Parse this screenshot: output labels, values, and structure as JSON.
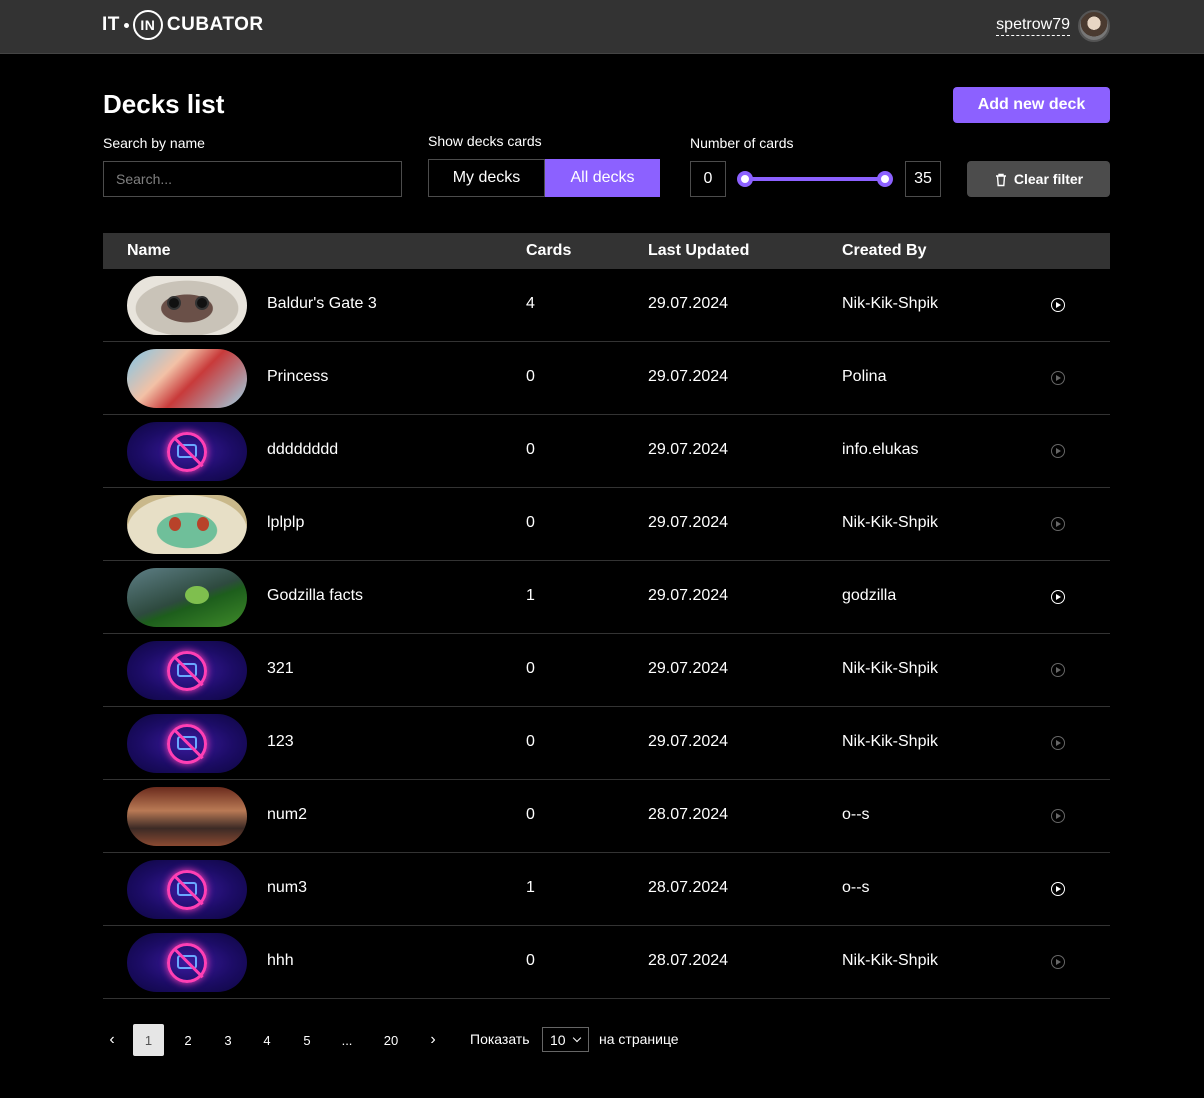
{
  "header": {
    "logo_left": "IT",
    "logo_ring": "IN",
    "logo_right": "CUBATOR",
    "username": "spetrow79"
  },
  "page": {
    "title": "Decks list",
    "add_button": "Add new deck"
  },
  "filters": {
    "search_label": "Search by name",
    "search_placeholder": "Search...",
    "search_value": "",
    "show_label": "Show decks cards",
    "tabs": [
      "My decks",
      "All decks"
    ],
    "active_tab": "All decks",
    "range_label": "Number of cards",
    "range_min": "0",
    "range_max": "35",
    "clear_button": "Clear filter"
  },
  "table": {
    "headers": [
      "Name",
      "Cards",
      "Last Updated",
      "Created By"
    ],
    "rows": [
      {
        "image": "baldur",
        "name": "Baldur's Gate 3",
        "cards": "4",
        "updated": "29.07.2024",
        "author": "Nik-Kik-Shpik",
        "play_active": true
      },
      {
        "image": "princess",
        "name": "Princess",
        "cards": "0",
        "updated": "29.07.2024",
        "author": "Polina",
        "play_active": false
      },
      {
        "image": "placeholder",
        "name": "dddddddd",
        "cards": "0",
        "updated": "29.07.2024",
        "author": "info.elukas",
        "play_active": false
      },
      {
        "image": "bulba",
        "name": "lplplp",
        "cards": "0",
        "updated": "29.07.2024",
        "author": "Nik-Kik-Shpik",
        "play_active": false
      },
      {
        "image": "frog",
        "name": "Godzilla facts",
        "cards": "1",
        "updated": "29.07.2024",
        "author": "godzilla",
        "play_active": true
      },
      {
        "image": "placeholder",
        "name": "321",
        "cards": "0",
        "updated": "29.07.2024",
        "author": "Nik-Kik-Shpik",
        "play_active": false
      },
      {
        "image": "placeholder",
        "name": "123",
        "cards": "0",
        "updated": "29.07.2024",
        "author": "Nik-Kik-Shpik",
        "play_active": false
      },
      {
        "image": "room",
        "name": "num2",
        "cards": "0",
        "updated": "28.07.2024",
        "author": "o--s",
        "play_active": false
      },
      {
        "image": "placeholder",
        "name": "num3",
        "cards": "1",
        "updated": "28.07.2024",
        "author": "o--s",
        "play_active": true
      },
      {
        "image": "placeholder",
        "name": "hhh",
        "cards": "0",
        "updated": "28.07.2024",
        "author": "Nik-Kik-Shpik",
        "play_active": false
      }
    ]
  },
  "pagination": {
    "prev": "‹",
    "pages": [
      "1",
      "2",
      "3",
      "4",
      "5",
      "...",
      "20"
    ],
    "current": "1",
    "next": "›",
    "show_label": "Показать",
    "per_page": "10",
    "per_page_suffix": "на странице"
  },
  "colors": {
    "accent": "#8c61ff",
    "header_bg": "#333333",
    "background": "#000000"
  }
}
